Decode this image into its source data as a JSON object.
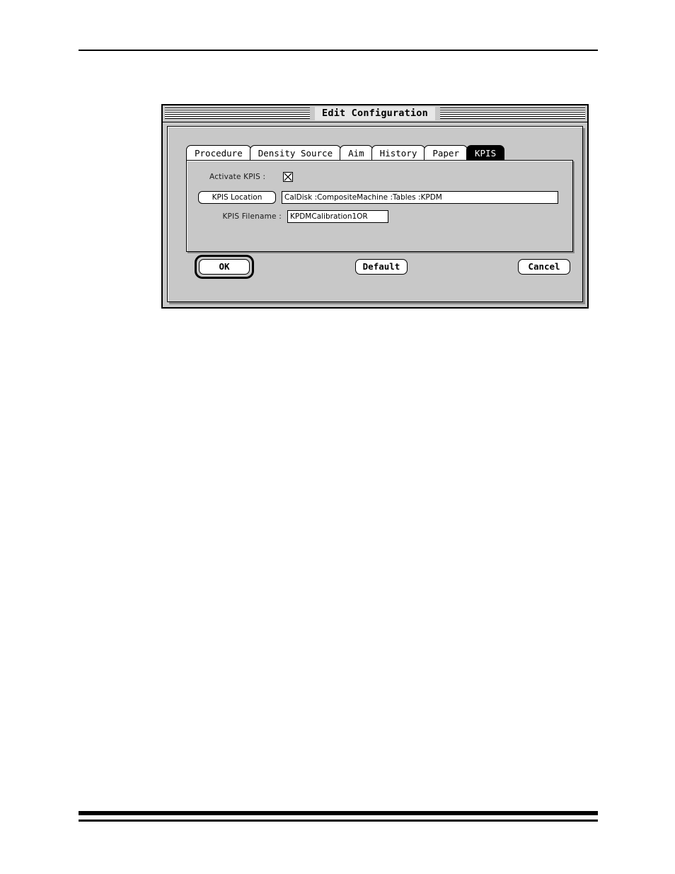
{
  "page": {
    "top_rule": "horizontal-rule",
    "bottom_rule_thick": "horizontal-rule-thick",
    "bottom_rule_thin": "horizontal-rule-thin"
  },
  "dialog": {
    "title": "Edit Configuration",
    "tabs": [
      {
        "label": "Procedure",
        "selected": false
      },
      {
        "label": "Density Source",
        "selected": false
      },
      {
        "label": "Aim",
        "selected": false
      },
      {
        "label": "History",
        "selected": false
      },
      {
        "label": "Paper",
        "selected": false
      },
      {
        "label": "KPIS",
        "selected": true
      }
    ],
    "panel": {
      "activate": {
        "label": "Activate KPIS :",
        "checked": true,
        "checkbox_glyph": "x-mark"
      },
      "location": {
        "button_label": "KPIS Location",
        "value": "CalDisk :CompositeMachine :Tables :KPDM",
        "placeholder": ""
      },
      "filename": {
        "label": "KPIS Filename :",
        "value": "KPDMCalibration1OR",
        "placeholder": ""
      }
    },
    "buttons": {
      "ok": "OK",
      "default": "Default",
      "cancel": "Cancel",
      "default_action": "ok"
    },
    "colors": {
      "window_gray": "#c8c8c8",
      "selected_tab_bg": "#000000",
      "selected_tab_fg": "#ffffff",
      "field_bg": "#ffffff",
      "border": "#000000",
      "shadow": "#8a8a8a",
      "title_plate": "#e8e8e8"
    }
  }
}
